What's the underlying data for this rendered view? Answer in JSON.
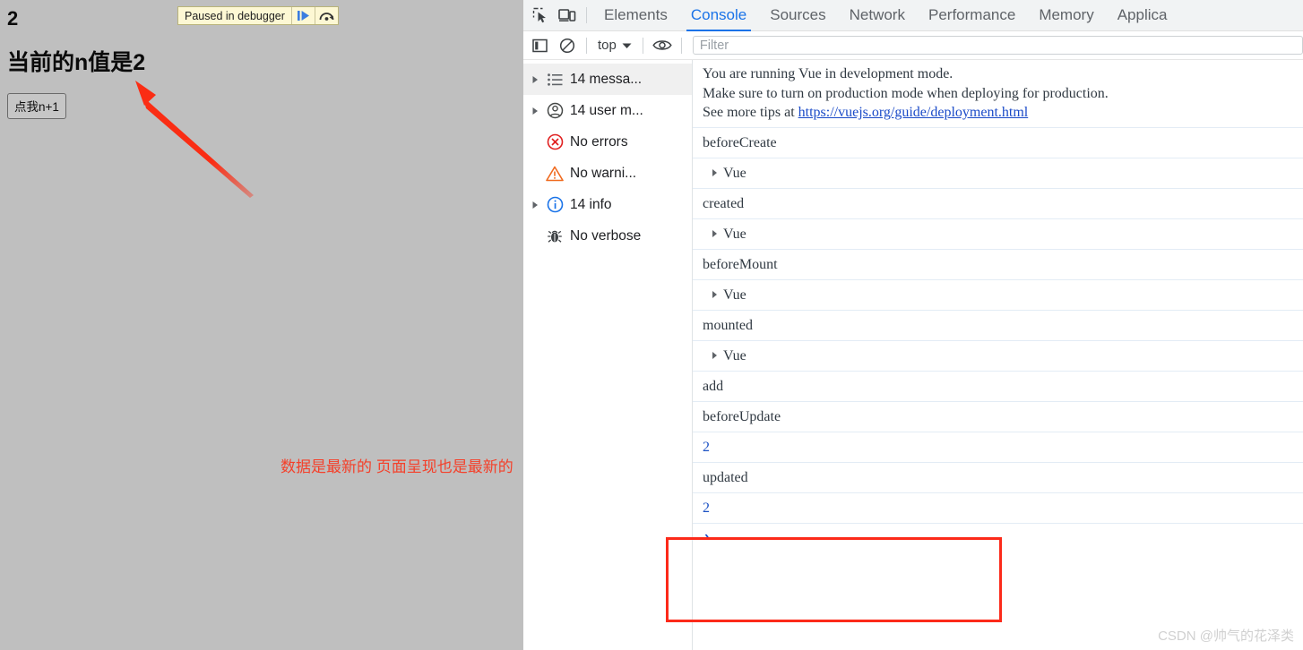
{
  "page": {
    "n_value": "2",
    "heading": "当前的n值是2",
    "button_label": "点我n+1",
    "annotation": "数据是最新的 页面呈现也是最新的",
    "background_color": "#bfbfbf",
    "annotation_color": "#f4402a"
  },
  "paused_overlay": {
    "label": "Paused in debugger",
    "resume_icon": "resume-script-icon",
    "step_over_icon": "step-over-icon",
    "background_color": "#fdf8d4"
  },
  "devtools": {
    "accent_color": "#1a73e8",
    "toolbar_icons": {
      "inspect": "inspect-element-icon",
      "device": "device-toolbar-icon"
    },
    "tabs": [
      {
        "label": "Elements",
        "active": false
      },
      {
        "label": "Console",
        "active": true
      },
      {
        "label": "Sources",
        "active": false
      },
      {
        "label": "Network",
        "active": false
      },
      {
        "label": "Performance",
        "active": false
      },
      {
        "label": "Memory",
        "active": false
      },
      {
        "label": "Applica",
        "active": false
      }
    ],
    "console_toolbar": {
      "sidebar_toggle_icon": "show-console-sidebar-icon",
      "clear_icon": "clear-console-icon",
      "context_label": "top",
      "context_caret_icon": "chevron-down-icon",
      "live_expression_icon": "eye-icon",
      "filter_placeholder": "Filter",
      "filter_value": ""
    },
    "sidebar": [
      {
        "label": "14 messa...",
        "icon": "list-icon",
        "expandable": true,
        "selected": true
      },
      {
        "label": "14 user m...",
        "icon": "user-icon",
        "expandable": true,
        "selected": false
      },
      {
        "label": "No errors",
        "icon": "error-icon",
        "expandable": false,
        "selected": false
      },
      {
        "label": "No warni...",
        "icon": "warning-icon",
        "expandable": false,
        "selected": false
      },
      {
        "label": "14 info",
        "icon": "info-icon",
        "expandable": true,
        "selected": false
      },
      {
        "label": "No verbose",
        "icon": "verbose-bug-icon",
        "expandable": false,
        "selected": false
      }
    ],
    "messages": [
      {
        "type": "info-multiline",
        "line1": "You are running Vue in development mode.",
        "line2": "Make sure to turn on production mode when deploying for production.",
        "line3_prefix": "See more tips at ",
        "link": "https://vuejs.org/guide/deployment.html"
      },
      {
        "type": "text",
        "text": "beforeCreate"
      },
      {
        "type": "object",
        "text": "Vue"
      },
      {
        "type": "text",
        "text": "created"
      },
      {
        "type": "object",
        "text": "Vue"
      },
      {
        "type": "text",
        "text": "beforeMount"
      },
      {
        "type": "object",
        "text": "Vue"
      },
      {
        "type": "text",
        "text": "mounted"
      },
      {
        "type": "object",
        "text": "Vue"
      },
      {
        "type": "text",
        "text": "add"
      },
      {
        "type": "text",
        "text": "beforeUpdate"
      },
      {
        "type": "number",
        "text": "2"
      },
      {
        "type": "text",
        "text": "updated"
      },
      {
        "type": "number",
        "text": "2"
      }
    ],
    "prompt": {
      "caret": "›",
      "value": ""
    },
    "highlight_box_color": "#fc2a1a"
  },
  "watermark": "CSDN @帅气的花泽类"
}
